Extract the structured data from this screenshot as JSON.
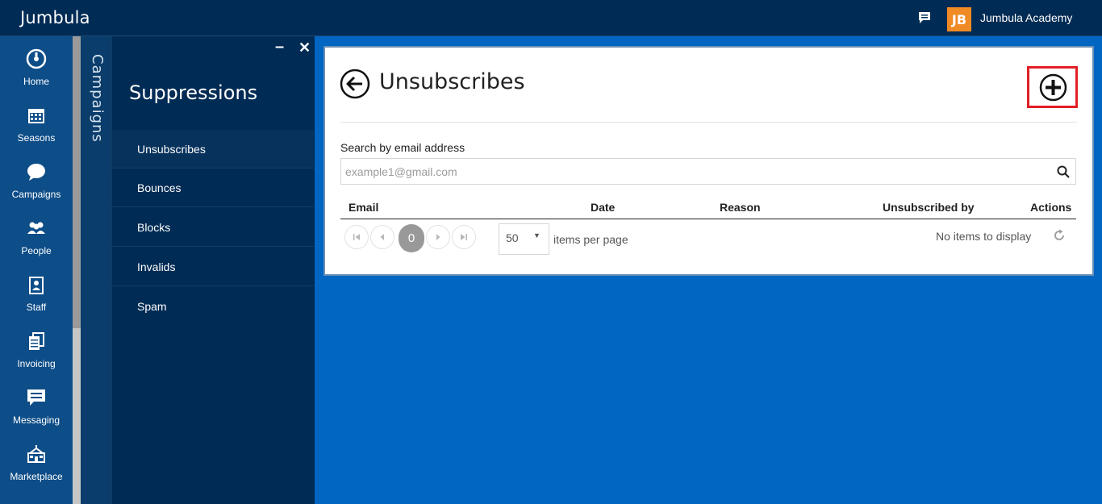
{
  "app": {
    "title": "Jumbula"
  },
  "topbar": {
    "org_logo_text": "JB",
    "org_name": "Jumbula Academy",
    "chat_icon": "chat-bubble-icon"
  },
  "leftnav": {
    "items": [
      {
        "label": "Home",
        "icon": "home-icon"
      },
      {
        "label": "Seasons",
        "icon": "calendar-icon"
      },
      {
        "label": "Campaigns",
        "icon": "campaigns-icon"
      },
      {
        "label": "People",
        "icon": "people-icon"
      },
      {
        "label": "Staff",
        "icon": "staff-icon"
      },
      {
        "label": "Invoicing",
        "icon": "invoicing-icon"
      },
      {
        "label": "Messaging",
        "icon": "messaging-icon"
      },
      {
        "label": "Marketplace",
        "icon": "marketplace-icon"
      }
    ]
  },
  "strip": {
    "label": "Campaigns"
  },
  "panel": {
    "title": "Suppressions",
    "items": [
      {
        "label": "Unsubscribes",
        "active": true
      },
      {
        "label": "Bounces",
        "active": false
      },
      {
        "label": "Blocks",
        "active": false
      },
      {
        "label": "Invalids",
        "active": false
      },
      {
        "label": "Spam",
        "active": false
      }
    ]
  },
  "main": {
    "title": "Unsubscribes",
    "search": {
      "label": "Search by email address",
      "placeholder": "example1@gmail.com",
      "value": ""
    },
    "table": {
      "columns": [
        "Email",
        "Date",
        "Reason",
        "Unsubscribed by",
        "Actions"
      ],
      "rows": []
    },
    "pager": {
      "current_page": "0",
      "page_size": "50",
      "page_size_label": "items per page",
      "empty_text": "No items to display"
    }
  },
  "colors": {
    "topbar": "#002b54",
    "leftnav": "#0d4d88",
    "content_bg": "#0066c2",
    "highlight": "#e11f26",
    "logo": "#f08a24"
  }
}
